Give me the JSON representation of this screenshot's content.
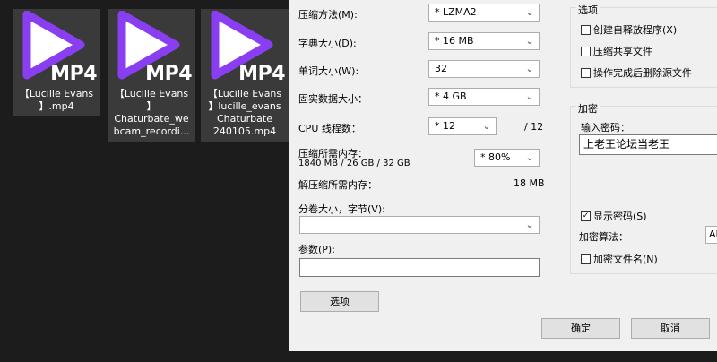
{
  "files": [
    {
      "name": "【Lucille Evans】.mp4",
      "badge": "MP4"
    },
    {
      "name": "【Lucille Evans】Chaturbate_webcam_recordi...",
      "badge": "MP4"
    },
    {
      "name": "【Lucille Evans】lucille_evans Chaturbate 240105.mp4",
      "badge": "MP4"
    }
  ],
  "files_display": [
    [
      "【Lucille Evans",
      "】.mp4"
    ],
    [
      "【Lucille Evans",
      "】",
      "Chaturbate_we",
      "bcam_recordi..."
    ],
    [
      "【Lucille Evans",
      "】lucille_evans",
      "Chaturbate",
      "240105.mp4"
    ]
  ],
  "dialog": {
    "compression_method": {
      "label": "压缩方法(M):",
      "value": "* LZMA2"
    },
    "dictionary_size": {
      "label": "字典大小(D):",
      "value": "* 16 MB"
    },
    "word_size": {
      "label": "单词大小(W):",
      "value": "32"
    },
    "solid_block_size": {
      "label": "固实数据大小：",
      "value": "* 4 GB"
    },
    "cpu_threads": {
      "label": "CPU 线程数：",
      "value": "* 12",
      "max": "/ 12"
    },
    "memory_compress": {
      "label": "压缩所需内存：",
      "detail": "1840 MB / 26 GB / 32 GB",
      "value": "* 80%"
    },
    "memory_decompress": {
      "label": "解压缩所需内存：",
      "value": "18 MB"
    },
    "volume_size": {
      "label": "分卷大小，字节(V):",
      "value": ""
    },
    "parameters": {
      "label": "参数(P):",
      "value": ""
    },
    "options_button": "选项",
    "options_group": {
      "title": "选项",
      "items": [
        {
          "label": "创建自释放程序(X)",
          "checked": false
        },
        {
          "label": "压缩共享文件",
          "checked": false
        },
        {
          "label": "操作完成后删除源文件",
          "checked": false
        }
      ]
    },
    "encryption_group": {
      "title": "加密",
      "password_label": "输入密码：",
      "password_value": "上老王论坛当老王",
      "show_password": {
        "label": "显示密码(S)",
        "checked": true
      },
      "method_label": "加密算法：",
      "method_value": "AE",
      "encrypt_names": {
        "label": "加密文件名(N)",
        "checked": false
      }
    },
    "ok_button": "确定",
    "cancel_button": "取消"
  },
  "colors": {
    "explorer_bg": "#1c1c1c",
    "dialog_bg": "#f0f0f0",
    "play_icon": "#8a3ef2"
  }
}
